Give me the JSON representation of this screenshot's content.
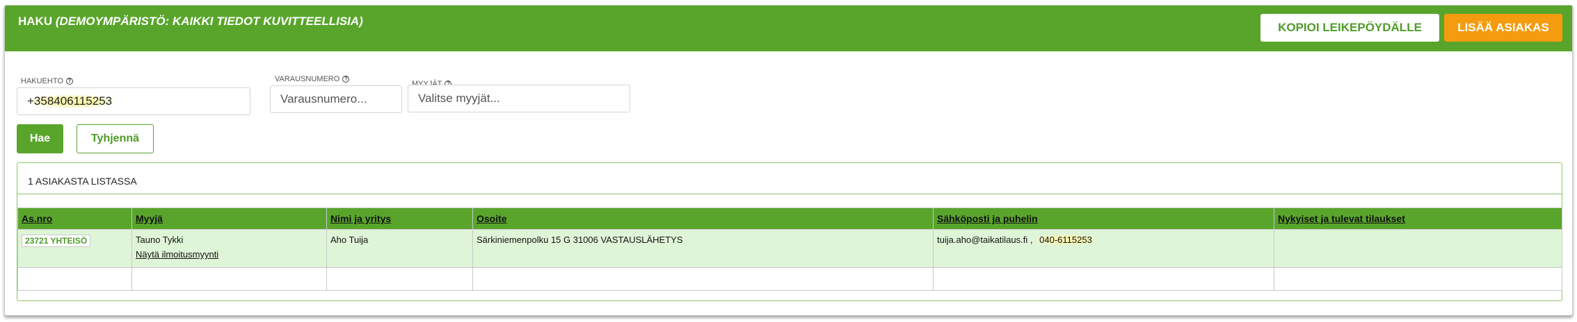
{
  "header": {
    "title": "HAKU",
    "subtitle": "(DEMOYMPÄRISTÖ: KAIKKI TIEDOT KUVITTEELLISIA)",
    "copy_button": "KOPIOI LEIKEPÖYDÄLLE",
    "add_button": "LISÄÄ ASIAKAS"
  },
  "search": {
    "hakuehto_label": "HAKUEHTO",
    "hakuehto_value": "+358406115253",
    "varausnumero_label": "VARAUSNUMERO",
    "varausnumero_placeholder": "Varausnumero...",
    "myyjat_label": "MYYJÄT",
    "myyjat_placeholder": "Valitse myyjät...",
    "help_glyph": "?"
  },
  "actions": {
    "search_button": "Hae",
    "clear_button": "Tyhjennä"
  },
  "results": {
    "count_text": "1 ASIAKASTA LISTASSA",
    "columns": [
      "As.nro",
      "Myyjä",
      "Nimi ja yritys",
      "Osoite",
      "Sähköposti ja puhelin",
      "Nykyiset ja tulevat tilaukset"
    ],
    "rows": [
      {
        "asnro": "23721 YHTEISÖ",
        "myyja": "Tauno Tykki",
        "myyja_link": "Näytä ilmoitusmyynti",
        "nimi": "Aho Tuija",
        "osoite": "Särkiniemenpolku 15 G 31006 VASTAUSLÄHETYS",
        "email": "tuija.aho@taikatilaus.fi",
        "separator": ",",
        "phone": "040-6115253",
        "tilaukset": ""
      }
    ]
  },
  "colors": {
    "brand_green": "#59a52c",
    "accent_orange": "#f59b0f",
    "row_highlight": "#dff5d8"
  }
}
